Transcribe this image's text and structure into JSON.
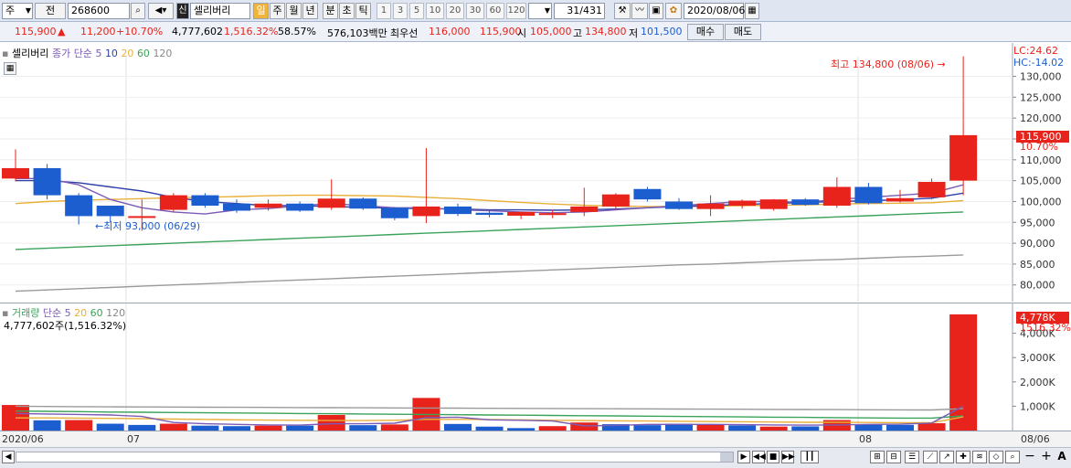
{
  "toolbar": {
    "market": "주",
    "jeon": "전",
    "code": "268600",
    "search_icon": "magnifier-icon",
    "sound_icon": "speaker-icon",
    "sin": "신",
    "name": "셀리버리",
    "periods": [
      "일",
      "주",
      "월",
      "년",
      "분",
      "초",
      "틱"
    ],
    "active_period": "일",
    "numbers": [
      "1",
      "3",
      "5",
      "10",
      "20",
      "30",
      "60",
      "120"
    ],
    "count": "31",
    "count_total": "/431",
    "date": "2020/08/06"
  },
  "quote": {
    "price": "115,900",
    "arrow": "▲",
    "change": "11,200",
    "change_pct": "+10.70%",
    "volume": "4,777,602",
    "vol_ratio": "1,516.32%",
    "turnover": "58.57%",
    "amount": "576,103백만",
    "best_label": "최우선",
    "best_ask": "116,000",
    "best_bid": "115,900",
    "open_label": "시",
    "open": "105,000",
    "high_label": "고",
    "high": "134,800",
    "low_label": "저",
    "low": "101,500",
    "buy": "매수",
    "sell": "매도"
  },
  "price_pane": {
    "legend_name": "셀리버리",
    "legend_type": "종가 단순",
    "ma": [
      "5",
      "10",
      "20",
      "60",
      "120"
    ],
    "lc": "LC:24.62",
    "hc": "HC:-14.02",
    "max_note": "최고 134,800 (08/06) →",
    "min_note": "←최저 93,000 (06/29)",
    "last_price": "115,900",
    "last_pct": "10.70%"
  },
  "volume_pane": {
    "legend_name": "거래량",
    "legend_type": "단순",
    "ma": [
      "5",
      "20",
      "60",
      "120"
    ],
    "summary": "4,777,602주(1,516.32%)",
    "last_vol": "4,778K",
    "last_pct": "1516.32%"
  },
  "date_axis": {
    "labels": [
      "2020/06",
      "07",
      "08",
      "08/06"
    ]
  },
  "colors": {
    "up": "#e8231b",
    "down": "#1c5dd0",
    "ma5": "#7b5bb5",
    "ma10": "#2d3fa8",
    "ma20": "#e8b03a",
    "ma60": "#3aa35a",
    "ma120": "#9a9a9a"
  },
  "chart_data": [
    {
      "type": "candlestick",
      "title": "셀리버리",
      "ylim": [
        76000,
        138000
      ],
      "yticks": [
        80000,
        85000,
        90000,
        95000,
        100000,
        105000,
        110000,
        115000,
        120000,
        125000,
        130000
      ],
      "candles": [
        {
          "o": 105500,
          "h": 112500,
          "l": 104800,
          "c": 108000
        },
        {
          "o": 108000,
          "h": 109000,
          "l": 100500,
          "c": 101500
        },
        {
          "o": 101500,
          "h": 102000,
          "l": 94500,
          "c": 96500
        },
        {
          "o": 99000,
          "h": 99000,
          "l": 95000,
          "c": 96500
        },
        {
          "o": 96200,
          "h": 100500,
          "l": 93000,
          "c": 96500
        },
        {
          "o": 98000,
          "h": 102000,
          "l": 97500,
          "c": 101500
        },
        {
          "o": 101500,
          "h": 102000,
          "l": 98500,
          "c": 99000
        },
        {
          "o": 99500,
          "h": 100500,
          "l": 97300,
          "c": 97800
        },
        {
          "o": 98500,
          "h": 100500,
          "l": 97800,
          "c": 99500
        },
        {
          "o": 99500,
          "h": 100000,
          "l": 97500,
          "c": 97800
        },
        {
          "o": 98500,
          "h": 105300,
          "l": 98000,
          "c": 100700
        },
        {
          "o": 100700,
          "h": 101000,
          "l": 98000,
          "c": 98300
        },
        {
          "o": 98500,
          "h": 98700,
          "l": 95500,
          "c": 96000
        },
        {
          "o": 96500,
          "h": 112800,
          "l": 94800,
          "c": 98800
        },
        {
          "o": 98800,
          "h": 99500,
          "l": 96500,
          "c": 97000
        },
        {
          "o": 97300,
          "h": 98000,
          "l": 96200,
          "c": 96800
        },
        {
          "o": 96600,
          "h": 97500,
          "l": 95800,
          "c": 97500
        },
        {
          "o": 97000,
          "h": 98000,
          "l": 96000,
          "c": 97200
        },
        {
          "o": 97500,
          "h": 103300,
          "l": 96500,
          "c": 98800
        },
        {
          "o": 98800,
          "h": 102000,
          "l": 98000,
          "c": 101700
        },
        {
          "o": 103000,
          "h": 103500,
          "l": 100000,
          "c": 100500
        },
        {
          "o": 100000,
          "h": 100800,
          "l": 98000,
          "c": 98200
        },
        {
          "o": 98200,
          "h": 101500,
          "l": 96500,
          "c": 99500
        },
        {
          "o": 99000,
          "h": 100500,
          "l": 98300,
          "c": 100200
        },
        {
          "o": 98200,
          "h": 100600,
          "l": 97800,
          "c": 100500
        },
        {
          "o": 100500,
          "h": 100800,
          "l": 99000,
          "c": 99200
        },
        {
          "o": 99000,
          "h": 105800,
          "l": 98500,
          "c": 103500
        },
        {
          "o": 103500,
          "h": 104500,
          "l": 99300,
          "c": 99600
        },
        {
          "o": 100000,
          "h": 102800,
          "l": 99800,
          "c": 100800
        },
        {
          "o": 101000,
          "h": 105500,
          "l": 100500,
          "c": 104700
        },
        {
          "o": 105000,
          "h": 134800,
          "l": 101500,
          "c": 115900
        }
      ],
      "ma_lines": {
        "ma5": [
          105500,
          105500,
          104000,
          100500,
          98500,
          97500,
          97000,
          98000,
          98300,
          99000,
          99500,
          99000,
          98500,
          98500,
          98000,
          97800,
          97500,
          97300,
          97500,
          98000,
          98500,
          99000,
          99500,
          100000,
          100000,
          99800,
          100500,
          101000,
          101500,
          102000,
          104000
        ],
        "ma10": [
          105000,
          105000,
          104500,
          103500,
          102500,
          101000,
          100000,
          99500,
          99000,
          99000,
          98800,
          98600,
          98400,
          98300,
          98200,
          98000,
          98000,
          97900,
          98000,
          98200,
          98500,
          98800,
          99000,
          99300,
          99500,
          99800,
          100000,
          100200,
          100400,
          100800,
          102000
        ],
        "ma20": [
          99500,
          100000,
          100300,
          100500,
          100700,
          100900,
          101000,
          101200,
          101400,
          101500,
          101500,
          101400,
          101300,
          101000,
          100700,
          100200,
          99800,
          99400,
          99100,
          98900,
          98800,
          98800,
          98900,
          99000,
          99100,
          99200,
          99400,
          99500,
          99600,
          99700,
          100200
        ],
        "ma60": [
          88500,
          88800,
          89100,
          89400,
          89700,
          90000,
          90300,
          90600,
          90900,
          91200,
          91500,
          91800,
          92100,
          92400,
          92700,
          93000,
          93300,
          93600,
          93900,
          94200,
          94500,
          94800,
          95100,
          95400,
          95700,
          96000,
          96300,
          96600,
          96900,
          97200,
          97500
        ],
        "ma120": [
          78500,
          78800,
          79100,
          79400,
          79700,
          80000,
          80300,
          80600,
          80900,
          81200,
          81500,
          81800,
          82100,
          82400,
          82700,
          83000,
          83300,
          83600,
          83900,
          84200,
          84500,
          84800,
          85000,
          85300,
          85600,
          85900,
          86100,
          86400,
          86700,
          86900,
          87200
        ]
      }
    },
    {
      "type": "bar",
      "title": "거래량",
      "ylim": [
        0,
        5000
      ],
      "yticks": [
        1000,
        2000,
        3000,
        4000
      ],
      "ylabel_unit": "K",
      "values": [
        1050,
        420,
        430,
        280,
        230,
        280,
        200,
        180,
        200,
        200,
        640,
        220,
        250,
        1340,
        270,
        160,
        100,
        180,
        330,
        260,
        220,
        280,
        230,
        210,
        160,
        170,
        430,
        240,
        230,
        300,
        4778
      ],
      "up": [
        true,
        false,
        true,
        false,
        false,
        true,
        false,
        false,
        true,
        false,
        true,
        false,
        true,
        true,
        false,
        false,
        false,
        true,
        true,
        false,
        false,
        false,
        true,
        false,
        true,
        false,
        true,
        false,
        false,
        true,
        true
      ],
      "ma_lines": {
        "ma5": [
          700,
          680,
          660,
          640,
          580,
          330,
          280,
          250,
          230,
          220,
          280,
          280,
          300,
          530,
          550,
          440,
          420,
          390,
          190,
          210,
          250,
          250,
          250,
          240,
          230,
          220,
          230,
          250,
          260,
          310,
          1000
        ],
        "ma20": [
          520,
          520,
          510,
          500,
          490,
          470,
          460,
          440,
          430,
          420,
          410,
          410,
          420,
          460,
          460,
          450,
          440,
          420,
          410,
          400,
          390,
          380,
          370,
          360,
          350,
          340,
          340,
          330,
          320,
          320,
          560
        ],
        "ma60": [
          800,
          790,
          780,
          760,
          750,
          740,
          730,
          720,
          710,
          700,
          690,
          680,
          670,
          660,
          650,
          640,
          630,
          620,
          610,
          600,
          590,
          580,
          570,
          560,
          550,
          540,
          530,
          520,
          510,
          510,
          600
        ],
        "ma120": [
          1000,
          990,
          980,
          975,
          970,
          965,
          960,
          955,
          950,
          945,
          940,
          935,
          930,
          925,
          920,
          915,
          910,
          905,
          900,
          895,
          890,
          885,
          880,
          875,
          870,
          865,
          860,
          855,
          850,
          845,
          900
        ]
      }
    }
  ]
}
